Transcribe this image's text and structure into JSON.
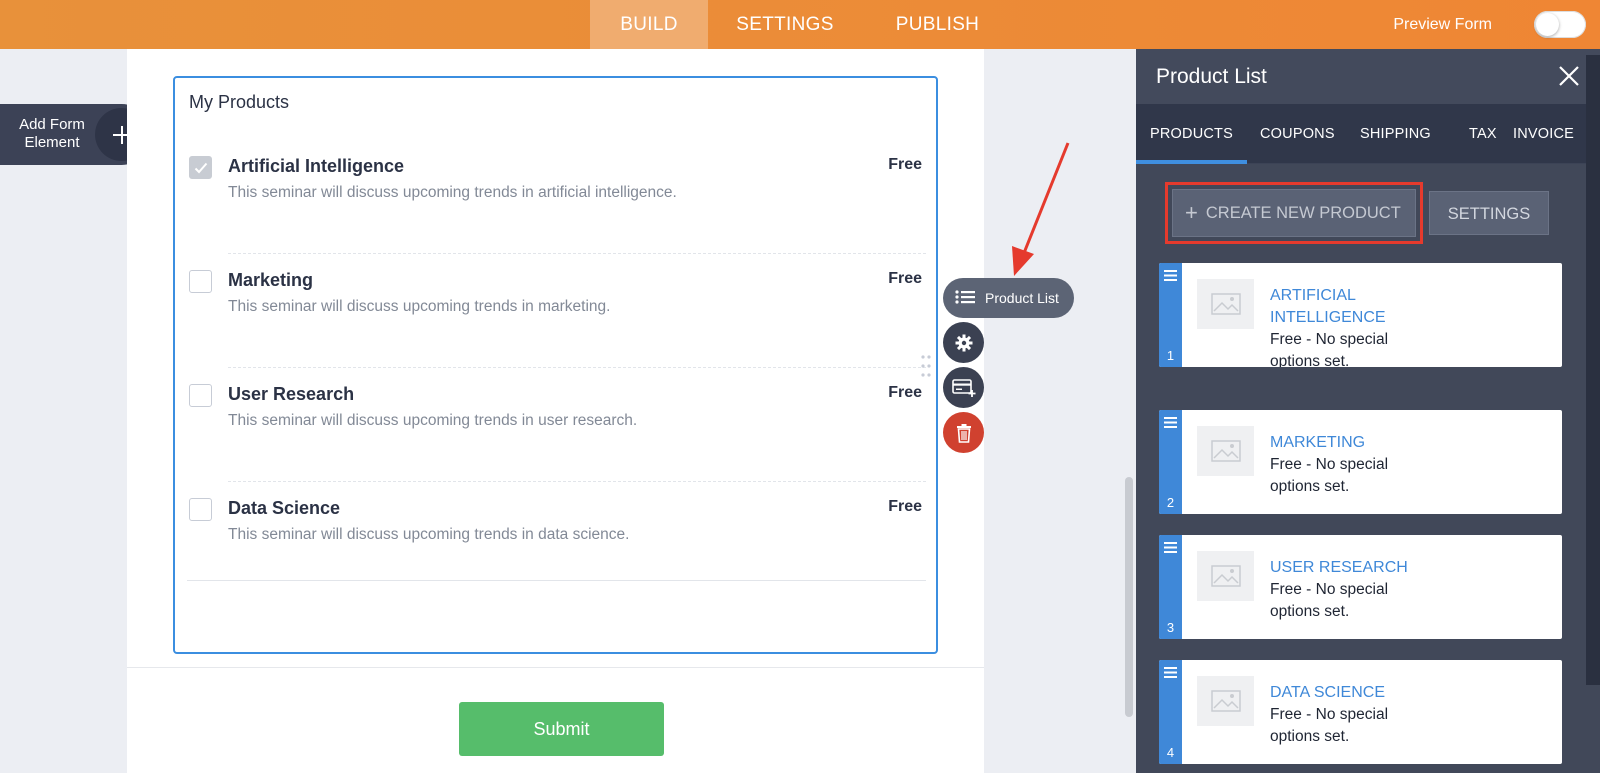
{
  "topbar": {
    "tabs": [
      {
        "label": "BUILD",
        "active": true
      },
      {
        "label": "SETTINGS",
        "active": false
      },
      {
        "label": "PUBLISH",
        "active": false
      }
    ],
    "preview_label": "Preview Form",
    "preview_on": false,
    "accent": "#ec8b37"
  },
  "add_element": {
    "label": "Add Form Element"
  },
  "form": {
    "title": "My Products",
    "products": [
      {
        "name": "Artificial Intelligence",
        "desc": "This seminar will discuss upcoming trends in artificial intelligence.",
        "price": "Free",
        "checked": true
      },
      {
        "name": "Marketing",
        "desc": "This seminar will discuss upcoming trends in marketing.",
        "price": "Free",
        "checked": false
      },
      {
        "name": "User Research",
        "desc": "This seminar will discuss upcoming trends in user research.",
        "price": "Free",
        "checked": false
      },
      {
        "name": "Data Science",
        "desc": "This seminar will discuss upcoming trends in data science.",
        "price": "Free",
        "checked": false
      }
    ],
    "submit_label": "Submit"
  },
  "float_tools": {
    "product_list_label": "Product List"
  },
  "panel": {
    "title": "Product List",
    "tabs": [
      "PRODUCTS",
      "COUPONS",
      "SHIPPING",
      "TAX",
      "INVOICE"
    ],
    "active_tab": "PRODUCTS",
    "create_label": "CREATE NEW PRODUCT",
    "settings_label": "SETTINGS",
    "products": [
      {
        "num": "1",
        "title": "ARTIFICIAL INTELLIGENCE",
        "meta": "Free - No special options set."
      },
      {
        "num": "2",
        "title": "MARKETING",
        "meta": "Free - No special options set."
      },
      {
        "num": "3",
        "title": "USER RESEARCH",
        "meta": "Free - No special options set."
      },
      {
        "num": "4",
        "title": "DATA SCIENCE",
        "meta": "Free - No special options set."
      }
    ]
  }
}
